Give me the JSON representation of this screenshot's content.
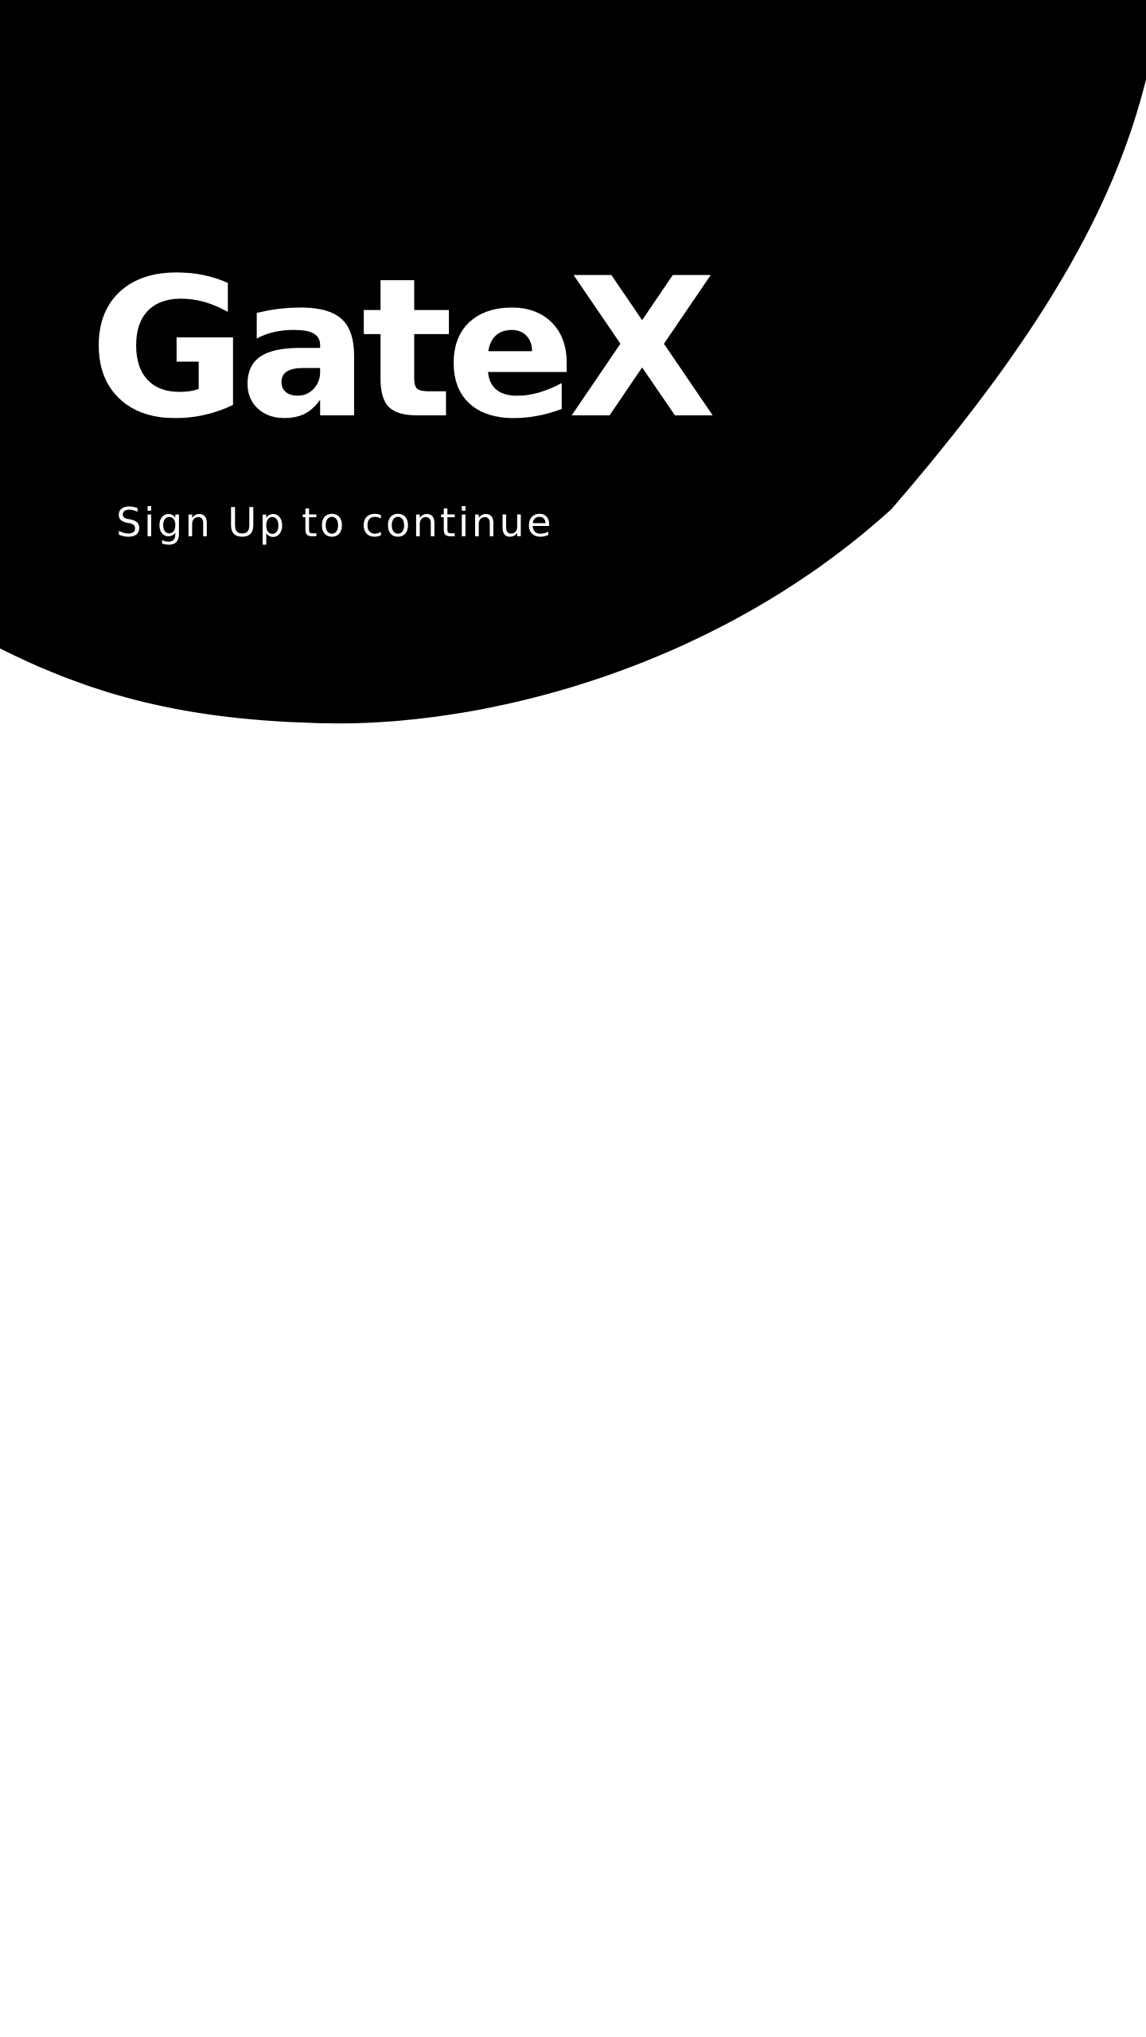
{
  "app": {
    "brand_name": "GateX",
    "subtitle": "Sign Up to continue"
  },
  "colors": {
    "hero_background": "#000000",
    "hero_text": "#ffffff",
    "page_background": "#ffffff"
  }
}
